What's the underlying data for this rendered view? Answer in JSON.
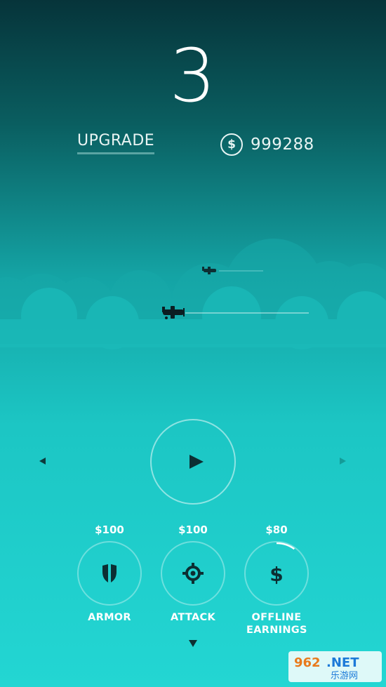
{
  "level": "3",
  "upgrade_label": "UPGRADE",
  "money": {
    "icon": "dollar-coin-icon",
    "amount": "999288"
  },
  "play": {
    "icon": "play-icon"
  },
  "nav": {
    "left_icon": "arrow-left-icon",
    "right_icon": "arrow-right-icon",
    "down_icon": "arrow-down-icon"
  },
  "upgrades": [
    {
      "price": "$100",
      "label": "ARMOR",
      "icon": "shield-icon"
    },
    {
      "price": "$100",
      "label": "ATTACK",
      "icon": "crosshair-icon"
    },
    {
      "price": "$80",
      "label": "OFFLINE EARNINGS",
      "icon": "dollar-icon",
      "progress": 0.1
    }
  ],
  "watermark": {
    "top": "962.NET",
    "bottom": "乐游网"
  },
  "colors": {
    "bg_top": "#06343a",
    "bg_bottom": "#23d6d3",
    "icon_dark": "#0c2f33",
    "text": "#ffffff"
  }
}
